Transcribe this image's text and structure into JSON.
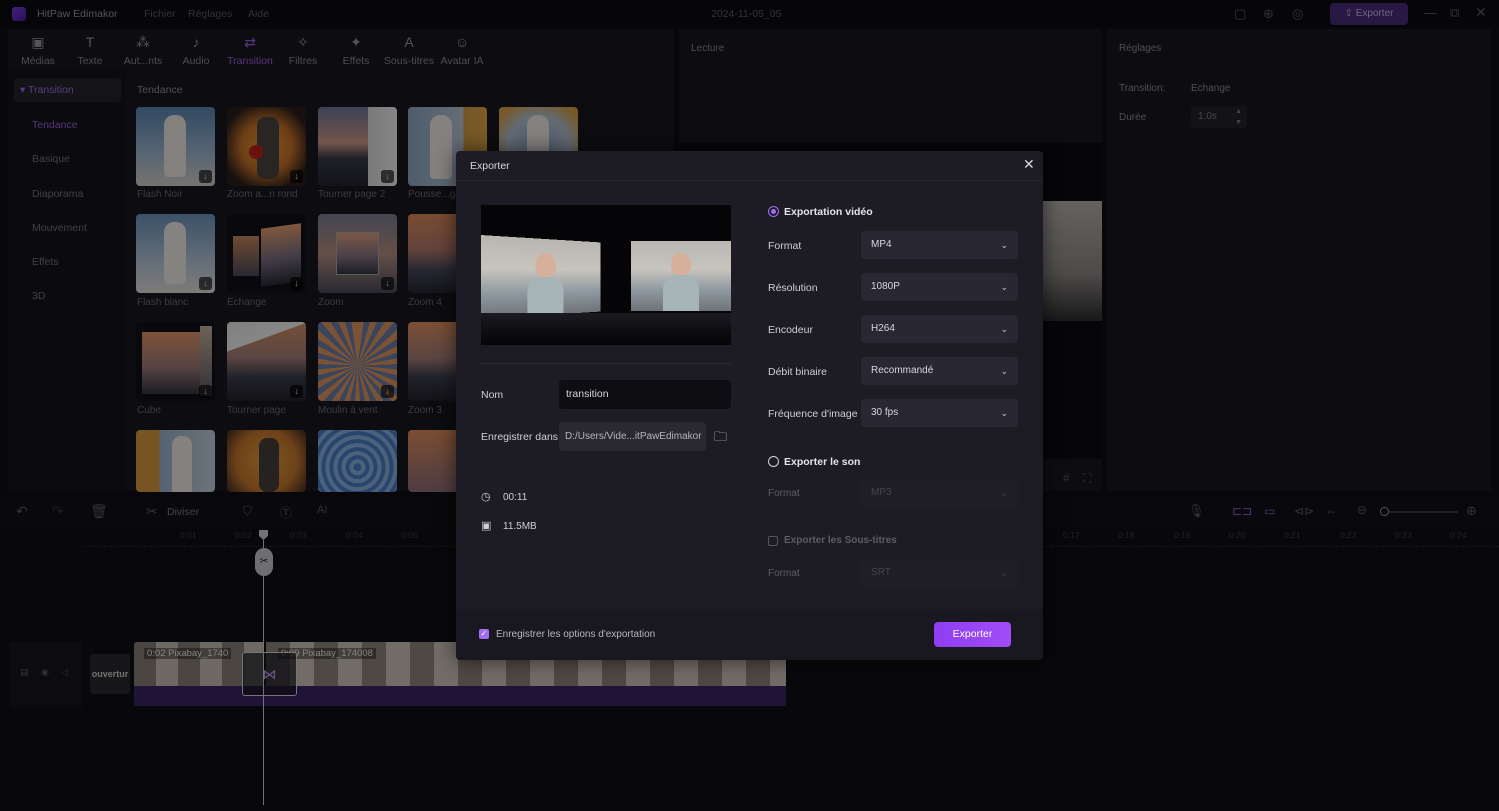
{
  "app": {
    "title": "HitPaw Edimakor",
    "menu": [
      "Fichier",
      "Réglages",
      "Aide"
    ],
    "date": "2024-11-05_05",
    "export_btn": "Exporter"
  },
  "toolbar": [
    "Médias",
    "Texte",
    "Aut...nts",
    "Audio",
    "Transition",
    "Filtres",
    "Effets",
    "Sous-titres",
    "Avatar IA"
  ],
  "sidebar": {
    "header": "Transition",
    "items": [
      "Tendance",
      "Basique",
      "Diaporama",
      "Mouvement",
      "Effets",
      "3D"
    ]
  },
  "library": {
    "section": "Tendance",
    "thumbs": [
      "Flash Noir",
      "Zoom a...n rond",
      "Tourner page 2",
      "Pousse...ga",
      "Flash blanc",
      "Echange",
      "Zoom",
      "Zoom 4",
      "Cube",
      "Tourner page",
      "Moulin à vent",
      "Zoom 3"
    ]
  },
  "preview": {
    "title": "Lecture"
  },
  "settings": {
    "title": "Réglages",
    "transition_label": "Transition:",
    "transition_value": "Echange",
    "duration_label": "Durée",
    "duration_value": "1.0s"
  },
  "timeline": {
    "split": "Diviser",
    "ticks": [
      "0:01",
      "0:02",
      "0:03",
      "0:04",
      "0:05",
      "0:17",
      "0:18",
      "0:19",
      "0:20",
      "0:21",
      "0:22",
      "0:23",
      "0:24"
    ],
    "clip1": "0:02  Pixabay_1740",
    "clip2": "0:09  Pixabay_174008",
    "track_label": "ouvertur"
  },
  "dialog": {
    "title": "Exporter",
    "name_label": "Nom",
    "name_value": "transition",
    "save_label": "Enregistrer dans",
    "save_path": "D:/Users/Vide...itPawEdimakor",
    "duration": "00:11",
    "size": "11.5MB",
    "video_radio": "Exportation vidéo",
    "format_label": "Format",
    "format_value": "MP4",
    "resolution_label": "Résolution",
    "resolution_value": "1080P",
    "encoder_label": "Encodeur",
    "encoder_value": "H264",
    "bitrate_label": "Débit binaire",
    "bitrate_value": "Recommandé",
    "fps_label": "Fréquence d'image",
    "fps_value": "30  fps",
    "audio_radio": "Exporter le son",
    "audio_format_label": "Format",
    "audio_format_value": "MP3",
    "subs_check": "Exporter les Sous-titres",
    "subs_format_label": "Format",
    "subs_format_value": "SRT",
    "save_options": "Enregistrer les options d'exportation",
    "export_button": "Exporter"
  },
  "colors": {
    "accent": "#8a3cf0",
    "bg": "#0f0e14",
    "panel": "#18171e",
    "dialog": "#1d1c24"
  }
}
